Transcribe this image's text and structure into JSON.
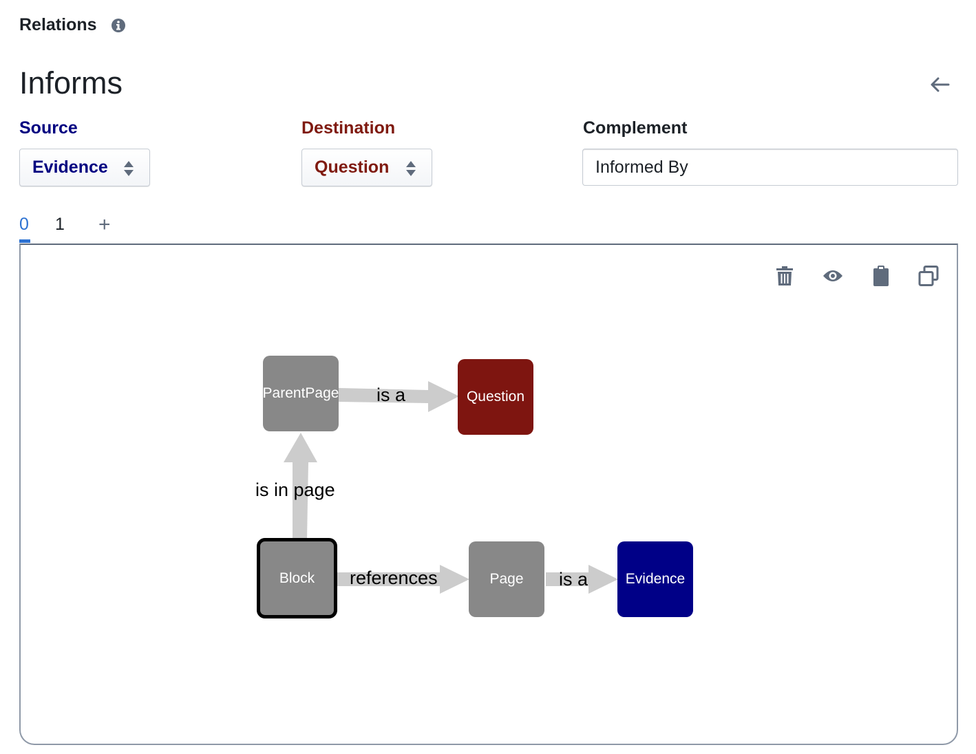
{
  "header": {
    "section_title": "Relations",
    "info_icon": "info-icon"
  },
  "relation": {
    "name": "Informs",
    "back_icon": "arrow-left-icon"
  },
  "fields": {
    "source_label": "Source",
    "source_value": "Evidence",
    "destination_label": "Destination",
    "destination_value": "Question",
    "complement_label": "Complement",
    "complement_value": "Informed By"
  },
  "tabs": {
    "items": [
      "0",
      "1"
    ],
    "add_label": "+",
    "active_index": 0
  },
  "toolbar": {
    "icons": [
      "trash-icon",
      "eye-icon",
      "clipboard-icon",
      "duplicate-icon"
    ]
  },
  "graph": {
    "nodes": {
      "parent_page": "ParentPage",
      "question": "Question",
      "block": "Block",
      "page": "Page",
      "evidence": "Evidence"
    },
    "edges": {
      "parent_is_a": "is a",
      "block_in_page": "is in page",
      "block_references": "references",
      "page_is_a": "is a"
    },
    "selected_node": "Block"
  },
  "colors": {
    "source": "#000080",
    "destination": "#7f1a10",
    "accent": "#2d72d2",
    "node_gray": "#888888",
    "node_question": "#7e1510",
    "node_evidence": "#000087",
    "edge": "#cccccc"
  }
}
